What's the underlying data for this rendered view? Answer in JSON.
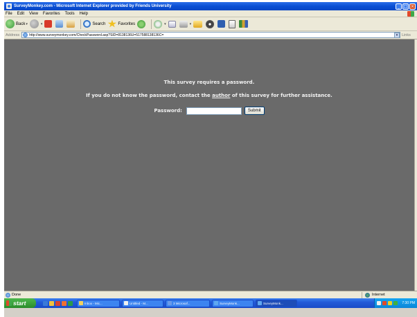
{
  "window": {
    "title": "SurveyMonkey.com - Microsoft Internet Explorer provided by Friends University",
    "controls": [
      "_",
      "□",
      "×"
    ]
  },
  "menu": [
    "File",
    "Edit",
    "View",
    "Favorites",
    "Tools",
    "Help"
  ],
  "toolbar": {
    "back_label": "Back",
    "search_label": "Search",
    "favorites_label": "Favorites"
  },
  "address": {
    "label": "Address",
    "url": "http://www.surveymonkey.com/CheckPassword.asp?SID=8138136U=517588138136C=",
    "links_label": "Links"
  },
  "content": {
    "message1": "This survey requires a password.",
    "message2_before": "If you do not know the password, contact the ",
    "message2_link": "author",
    "message2_after": " of this survey for further assistance.",
    "password_label": "Password:",
    "password_value": "",
    "submit_label": "Submit"
  },
  "status": {
    "text": "Done",
    "zone": "Internet"
  },
  "taskbar": {
    "start_label": "start",
    "tasks": [
      {
        "label": "Inbox - Mic..."
      },
      {
        "label": "Untitled - M..."
      },
      {
        "label": "3 Microsof..."
      },
      {
        "label": "SurveyMonk..."
      },
      {
        "label": "SurveyMonk..."
      }
    ],
    "clock": "7:30 PM"
  }
}
